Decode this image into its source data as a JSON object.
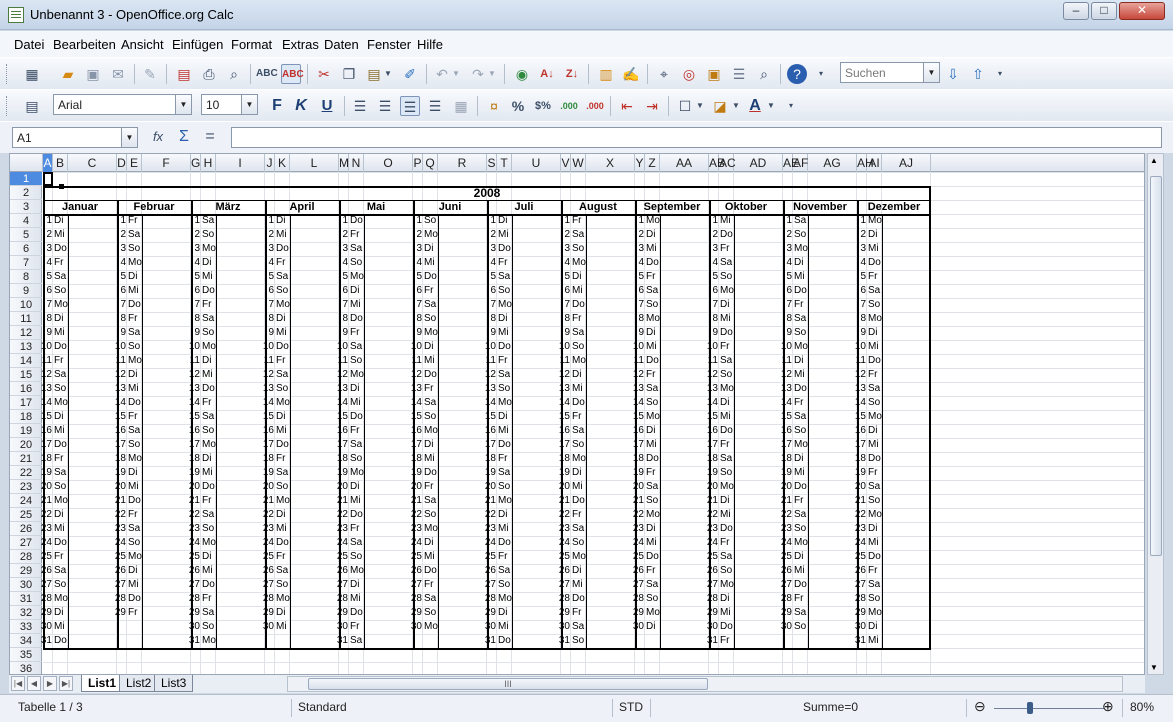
{
  "window": {
    "title": "Unbenannt 3 - OpenOffice.org Calc",
    "minimize": "–",
    "maximize": "□",
    "close": "✕"
  },
  "menu": [
    "Datei",
    "Bearbeiten",
    "Ansicht",
    "Einfügen",
    "Format",
    "Extras",
    "Daten",
    "Fenster",
    "Hilfe"
  ],
  "toolbar": {
    "search_placeholder": "Suchen"
  },
  "format": {
    "font": "Arial",
    "size": "10",
    "bold": "F",
    "italic": "K",
    "underline": "U"
  },
  "formula": {
    "namebox": "A1",
    "value": ""
  },
  "columns": [
    "A",
    "B",
    "C",
    "D",
    "E",
    "F",
    "G",
    "H",
    "I",
    "J",
    "K",
    "L",
    "M",
    "N",
    "O",
    "P",
    "Q",
    "R",
    "S",
    "T",
    "U",
    "V",
    "W",
    "X",
    "Y",
    "Z",
    "AA",
    "AB",
    "AC",
    "AD",
    "AE",
    "AF",
    "AG",
    "AH",
    "AI",
    "AJ"
  ],
  "rows": [
    "1",
    "2",
    "3",
    "4",
    "5",
    "6",
    "7",
    "8",
    "9",
    "10",
    "11",
    "12",
    "13",
    "14",
    "15",
    "16",
    "17",
    "18",
    "19",
    "20",
    "21",
    "22",
    "23",
    "24",
    "25",
    "26",
    "27",
    "28",
    "29",
    "30",
    "31",
    "32",
    "33",
    "34",
    "35",
    "36"
  ],
  "year": "2008",
  "months": [
    {
      "name": "Januar",
      "wd": [
        "Di",
        "Mi",
        "Do",
        "Fr",
        "Sa",
        "So",
        "Mo",
        "Di",
        "Mi",
        "Do",
        "Fr",
        "Sa",
        "So",
        "Mo",
        "Di",
        "Mi",
        "Do",
        "Fr",
        "Sa",
        "So",
        "Mo",
        "Di",
        "Mi",
        "Do",
        "Fr",
        "Sa",
        "So",
        "Mo",
        "Di",
        "Mi",
        "Do"
      ]
    },
    {
      "name": "Februar",
      "wd": [
        "Fr",
        "Sa",
        "So",
        "Mo",
        "Di",
        "Mi",
        "Do",
        "Fr",
        "Sa",
        "So",
        "Mo",
        "Di",
        "Mi",
        "Do",
        "Fr",
        "Sa",
        "So",
        "Mo",
        "Di",
        "Mi",
        "Do",
        "Fr",
        "Sa",
        "So",
        "Mo",
        "Di",
        "Mi",
        "Do",
        "Fr"
      ]
    },
    {
      "name": "März",
      "wd": [
        "Sa",
        "So",
        "Mo",
        "Di",
        "Mi",
        "Do",
        "Fr",
        "Sa",
        "So",
        "Mo",
        "Di",
        "Mi",
        "Do",
        "Fr",
        "Sa",
        "So",
        "Mo",
        "Di",
        "Mi",
        "Do",
        "Fr",
        "Sa",
        "So",
        "Mo",
        "Di",
        "Mi",
        "Do",
        "Fr",
        "Sa",
        "So",
        "Mo"
      ]
    },
    {
      "name": "April",
      "wd": [
        "Di",
        "Mi",
        "Do",
        "Fr",
        "Sa",
        "So",
        "Mo",
        "Di",
        "Mi",
        "Do",
        "Fr",
        "Sa",
        "So",
        "Mo",
        "Di",
        "Mi",
        "Do",
        "Fr",
        "Sa",
        "So",
        "Mo",
        "Di",
        "Mi",
        "Do",
        "Fr",
        "Sa",
        "So",
        "Mo",
        "Di",
        "Mi"
      ]
    },
    {
      "name": "Mai",
      "wd": [
        "Do",
        "Fr",
        "Sa",
        "So",
        "Mo",
        "Di",
        "Mi",
        "Do",
        "Fr",
        "Sa",
        "So",
        "Mo",
        "Di",
        "Mi",
        "Do",
        "Fr",
        "Sa",
        "So",
        "Mo",
        "Di",
        "Mi",
        "Do",
        "Fr",
        "Sa",
        "So",
        "Mo",
        "Di",
        "Mi",
        "Do",
        "Fr",
        "Sa"
      ]
    },
    {
      "name": "Juni",
      "wd": [
        "So",
        "Mo",
        "Di",
        "Mi",
        "Do",
        "Fr",
        "Sa",
        "So",
        "Mo",
        "Di",
        "Mi",
        "Do",
        "Fr",
        "Sa",
        "So",
        "Mo",
        "Di",
        "Mi",
        "Do",
        "Fr",
        "Sa",
        "So",
        "Mo",
        "Di",
        "Mi",
        "Do",
        "Fr",
        "Sa",
        "So",
        "Mo"
      ]
    },
    {
      "name": "Juli",
      "wd": [
        "Di",
        "Mi",
        "Do",
        "Fr",
        "Sa",
        "So",
        "Mo",
        "Di",
        "Mi",
        "Do",
        "Fr",
        "Sa",
        "So",
        "Mo",
        "Di",
        "Mi",
        "Do",
        "Fr",
        "Sa",
        "So",
        "Mo",
        "Di",
        "Mi",
        "Do",
        "Fr",
        "Sa",
        "So",
        "Mo",
        "Di",
        "Mi",
        "Do"
      ]
    },
    {
      "name": "August",
      "wd": [
        "Fr",
        "Sa",
        "So",
        "Mo",
        "Di",
        "Mi",
        "Do",
        "Fr",
        "Sa",
        "So",
        "Mo",
        "Di",
        "Mi",
        "Do",
        "Fr",
        "Sa",
        "So",
        "Mo",
        "Di",
        "Mi",
        "Do",
        "Fr",
        "Sa",
        "So",
        "Mo",
        "Di",
        "Mi",
        "Do",
        "Fr",
        "Sa",
        "So"
      ]
    },
    {
      "name": "September",
      "wd": [
        "Mo",
        "Di",
        "Mi",
        "Do",
        "Fr",
        "Sa",
        "So",
        "Mo",
        "Di",
        "Mi",
        "Do",
        "Fr",
        "Sa",
        "So",
        "Mo",
        "Di",
        "Mi",
        "Do",
        "Fr",
        "Sa",
        "So",
        "Mo",
        "Di",
        "Mi",
        "Do",
        "Fr",
        "Sa",
        "So",
        "Mo",
        "Di"
      ]
    },
    {
      "name": "Oktober",
      "wd": [
        "Mi",
        "Do",
        "Fr",
        "Sa",
        "So",
        "Mo",
        "Di",
        "Mi",
        "Do",
        "Fr",
        "Sa",
        "So",
        "Mo",
        "Di",
        "Mi",
        "Do",
        "Fr",
        "Sa",
        "So",
        "Mo",
        "Di",
        "Mi",
        "Do",
        "Fr",
        "Sa",
        "So",
        "Mo",
        "Di",
        "Mi",
        "Do",
        "Fr"
      ]
    },
    {
      "name": "November",
      "wd": [
        "Sa",
        "So",
        "Mo",
        "Di",
        "Mi",
        "Do",
        "Fr",
        "Sa",
        "So",
        "Mo",
        "Di",
        "Mi",
        "Do",
        "Fr",
        "Sa",
        "So",
        "Mo",
        "Di",
        "Mi",
        "Do",
        "Fr",
        "Sa",
        "So",
        "Mo",
        "Di",
        "Mi",
        "Do",
        "Fr",
        "Sa",
        "So"
      ]
    },
    {
      "name": "Dezember",
      "wd": [
        "Mo",
        "Di",
        "Mi",
        "Do",
        "Fr",
        "Sa",
        "So",
        "Mo",
        "Di",
        "Mi",
        "Do",
        "Fr",
        "Sa",
        "So",
        "Mo",
        "Di",
        "Mi",
        "Do",
        "Fr",
        "Sa",
        "So",
        "Mo",
        "Di",
        "Mi",
        "Do",
        "Fr",
        "Sa",
        "So",
        "Mo",
        "Di",
        "Mi"
      ]
    }
  ],
  "tabs": [
    "List1",
    "List2",
    "List3"
  ],
  "status": {
    "sheet": "Tabelle 1 / 3",
    "style": "Standard",
    "mode": "STD",
    "sum": "Summe=0",
    "zoom": "80%",
    "zoom_minus": "⊖",
    "zoom_plus": "⊕"
  }
}
